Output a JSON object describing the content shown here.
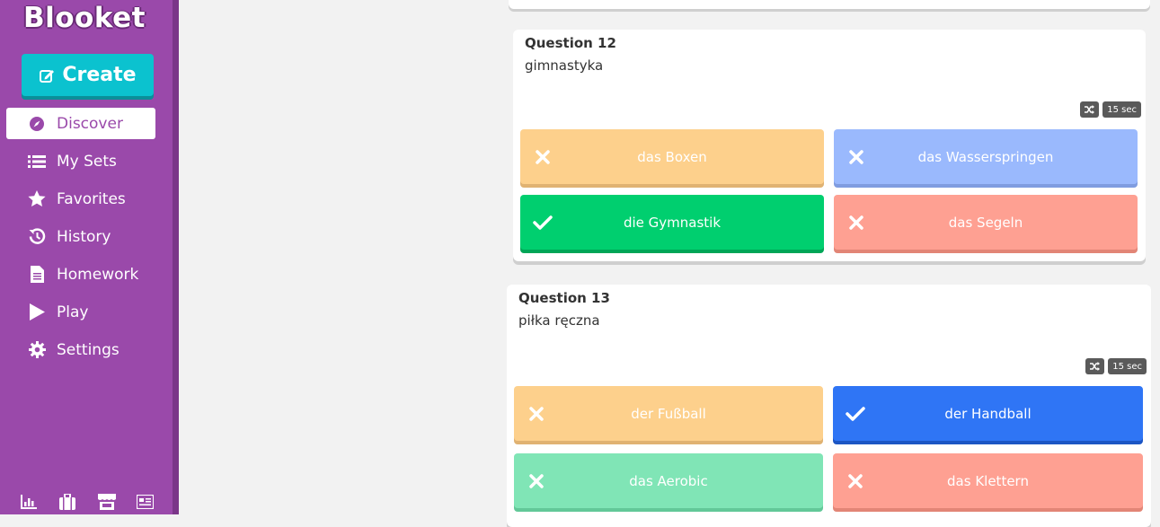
{
  "app": {
    "logo": "Blooket"
  },
  "sidebar": {
    "create_label": "Create",
    "items": [
      {
        "label": "Discover",
        "icon": "compass-icon",
        "active": true
      },
      {
        "label": "My Sets",
        "icon": "list-icon",
        "active": false
      },
      {
        "label": "Favorites",
        "icon": "star-icon",
        "active": false
      },
      {
        "label": "History",
        "icon": "history-icon",
        "active": false
      },
      {
        "label": "Homework",
        "icon": "document-icon",
        "active": false
      },
      {
        "label": "Play",
        "icon": "play-icon",
        "active": false
      },
      {
        "label": "Settings",
        "icon": "gear-icon",
        "active": false
      }
    ],
    "bottom_icons": [
      "stats-icon",
      "briefcase-icon",
      "store-icon",
      "news-icon"
    ]
  },
  "questions": [
    {
      "title": "Question 12",
      "text": "gimnastyka",
      "time": "15 sec",
      "answers": [
        {
          "label": "das Boxen",
          "correct": false,
          "color": "#fdd08c",
          "shadow": "#e0b272"
        },
        {
          "label": "das Wasserspringen",
          "correct": false,
          "color": "#9ab9fd",
          "shadow": "#7f9ce0"
        },
        {
          "label": "die Gymnastik",
          "correct": true,
          "color": "#00cf6f",
          "shadow": "#00a657"
        },
        {
          "label": "das Segeln",
          "correct": false,
          "color": "#fea092",
          "shadow": "#e28576"
        }
      ]
    },
    {
      "title": "Question 13",
      "text": "piłka ręczna",
      "time": "15 sec",
      "answers": [
        {
          "label": "der Fußball",
          "correct": false,
          "color": "#fdd08c",
          "shadow": "#e0b272"
        },
        {
          "label": "der Handball",
          "correct": true,
          "color": "#2f75f5",
          "shadow": "#1c56c4"
        },
        {
          "label": "das Aerobic",
          "correct": false,
          "color": "#80e5b6",
          "shadow": "#62c898"
        },
        {
          "label": "das Klettern",
          "correct": false,
          "color": "#fea092",
          "shadow": "#e28576"
        }
      ]
    }
  ],
  "colors": {
    "sidebar": "#9a49aa",
    "create": "#0bc2cf",
    "background": "#f2f2f2"
  }
}
